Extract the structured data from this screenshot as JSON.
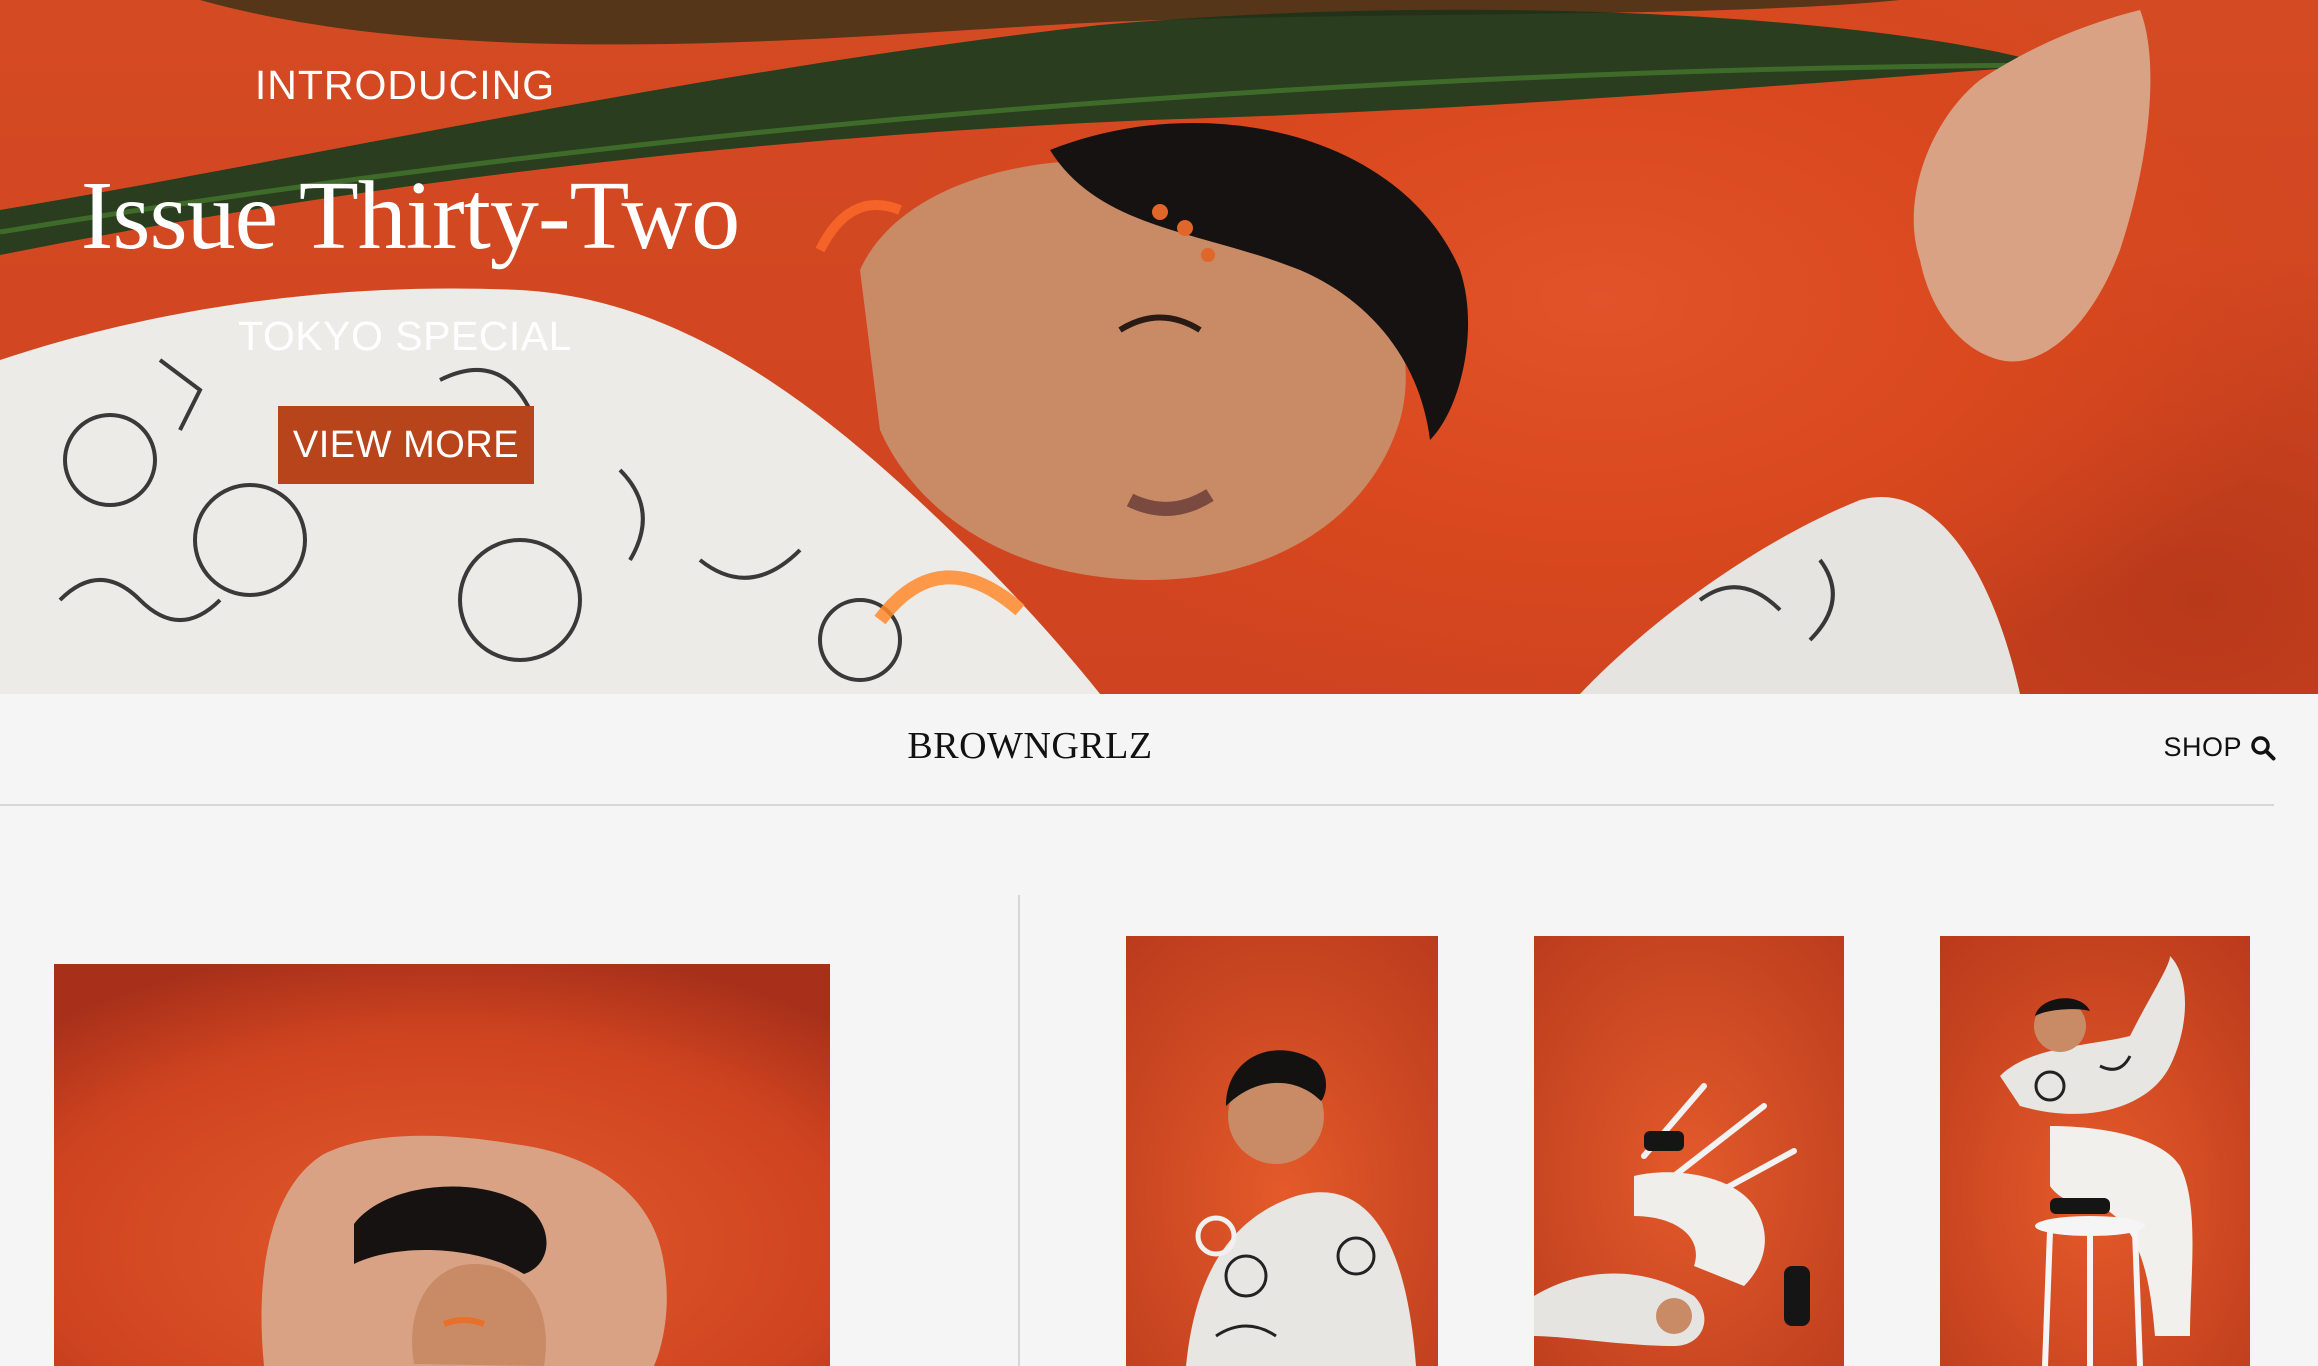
{
  "hero": {
    "kicker": "INTRODUCING",
    "title": "Issue Thirty-Two",
    "subtitle": "TOKYO SPECIAL",
    "button_label": "VIEW MORE",
    "button_color": "#b8441c",
    "background_color": "#d44a22"
  },
  "nav": {
    "brand": "BROWNGRLZ",
    "shop_label": "SHOP",
    "shop_icon": "search-icon"
  },
  "gallery": {
    "photos": [
      {
        "subject": "portrait-arms-over-head"
      },
      {
        "subject": "model-seated-with-earrings"
      },
      {
        "subject": "model-posing-with-stool"
      },
      {
        "subject": "model-standing-on-stool"
      }
    ]
  }
}
